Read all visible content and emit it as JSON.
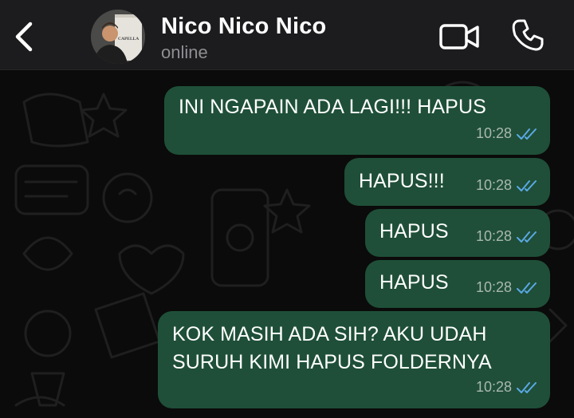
{
  "header": {
    "contact_name": "Nico Nico Nico",
    "status": "online",
    "avatar_sign_text": "CAPELLA"
  },
  "messages": [
    {
      "lines": [
        "INI NGAPAIN ADA LAGI!!! HAPUS"
      ],
      "time": "10:28",
      "status": "read"
    },
    {
      "lines": [
        "HAPUS!!!"
      ],
      "time": "10:28",
      "status": "read"
    },
    {
      "lines": [
        "HAPUS"
      ],
      "time": "10:28",
      "status": "read"
    },
    {
      "lines": [
        "HAPUS"
      ],
      "time": "10:28",
      "status": "read"
    },
    {
      "lines": [
        "KOK MASIH ADA SIH? AKU UDAH",
        "SURUH KIMI HAPUS FOLDERNYA"
      ],
      "time": "10:28",
      "status": "read"
    }
  ],
  "colors": {
    "header_bg": "#1c1c1e",
    "chat_bg": "#0b0b0b",
    "bubble_out": "#1f4f38",
    "read_tick": "#5aa9e6",
    "accent_icons": "#ffffff"
  },
  "icons": {
    "back": "chevron-left-icon",
    "video": "video-camera-icon",
    "call": "phone-icon",
    "read_receipt": "double-check-icon"
  }
}
